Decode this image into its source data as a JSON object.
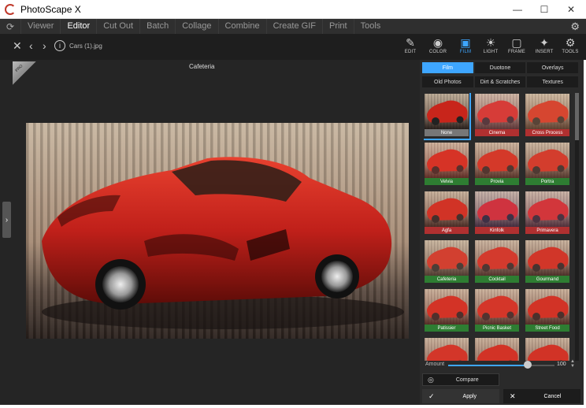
{
  "window": {
    "title": "PhotoScape X",
    "minimize": "—",
    "maximize": "☐",
    "close": "✕"
  },
  "menu": {
    "items": [
      "Viewer",
      "Editor",
      "Cut Out",
      "Batch",
      "Collage",
      "Combine",
      "Create GIF",
      "Print",
      "Tools"
    ],
    "active": "Editor"
  },
  "toolbar": {
    "filename": "Cars (1).jpg",
    "tools": [
      {
        "label": "EDIT",
        "icon": "✎"
      },
      {
        "label": "COLOR",
        "icon": "◉"
      },
      {
        "label": "FILM",
        "icon": "▣"
      },
      {
        "label": "LIGHT",
        "icon": "☀"
      },
      {
        "label": "FRAME",
        "icon": "▢"
      },
      {
        "label": "INSERT",
        "icon": "✦"
      },
      {
        "label": "TOOLS",
        "icon": "⚙"
      }
    ],
    "active_tool": "FILM"
  },
  "canvas": {
    "current_filter": "Cafeteria",
    "badge": "PRO"
  },
  "panel": {
    "tabs_row1": [
      "Film",
      "Duotone",
      "Overlays"
    ],
    "tabs_row2": [
      "Old Photos",
      "Dirt & Scratches",
      "Textures"
    ],
    "active_tab": "Film",
    "filters": [
      {
        "name": "None",
        "caption_color": "#777777"
      },
      {
        "name": "Cinema",
        "caption_color": "#b03030"
      },
      {
        "name": "Cross Process",
        "caption_color": "#b03030"
      },
      {
        "name": "Velvia",
        "caption_color": "#2e7d32"
      },
      {
        "name": "Provia",
        "caption_color": "#2e7d32"
      },
      {
        "name": "Portra",
        "caption_color": "#2e7d32"
      },
      {
        "name": "Agfa",
        "caption_color": "#b03030"
      },
      {
        "name": "Kinfolk",
        "caption_color": "#b03030"
      },
      {
        "name": "Primavera",
        "caption_color": "#b03030"
      },
      {
        "name": "Cafeteria",
        "caption_color": "#2e7d32"
      },
      {
        "name": "Cocktail",
        "caption_color": "#2e7d32"
      },
      {
        "name": "Gourmand",
        "caption_color": "#2e7d32"
      },
      {
        "name": "Patissier",
        "caption_color": "#2e7d32"
      },
      {
        "name": "Picnic Basket",
        "caption_color": "#2e7d32"
      },
      {
        "name": "Street Food",
        "caption_color": "#2e7d32"
      },
      {
        "name": "",
        "caption_color": "#2e7d32"
      },
      {
        "name": "",
        "caption_color": "#2e7d32"
      },
      {
        "name": "",
        "caption_color": "#2e7d32"
      }
    ],
    "selected_filter": "None",
    "hovered_filter": "Cafeteria",
    "amount_label": "Amount",
    "amount_value": "100",
    "amount_fraction": 0.75,
    "compare_label": "Compare",
    "apply_label": "Apply",
    "cancel_label": "Cancel"
  },
  "colors": {
    "accent": "#3ea6ff",
    "car_red": "#c0201a"
  }
}
